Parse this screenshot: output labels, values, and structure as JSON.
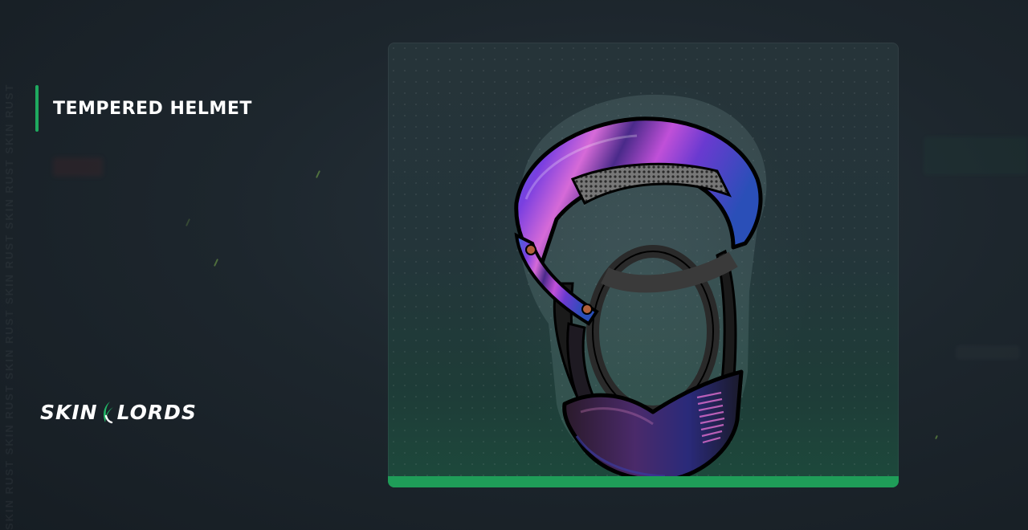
{
  "title": "TEMPERED HELMET",
  "brand": {
    "left": "SKIN",
    "right": "LORDS"
  },
  "watermark": "SKIN RUST SKIN RUST SKIN RUST SKIN RUST SKIN RUST SKIN RUST",
  "colors": {
    "accent": "#1fa95f",
    "card_bar": "#1f9d58",
    "background": "#1d262d"
  },
  "item": {
    "image": "helmet-image"
  }
}
